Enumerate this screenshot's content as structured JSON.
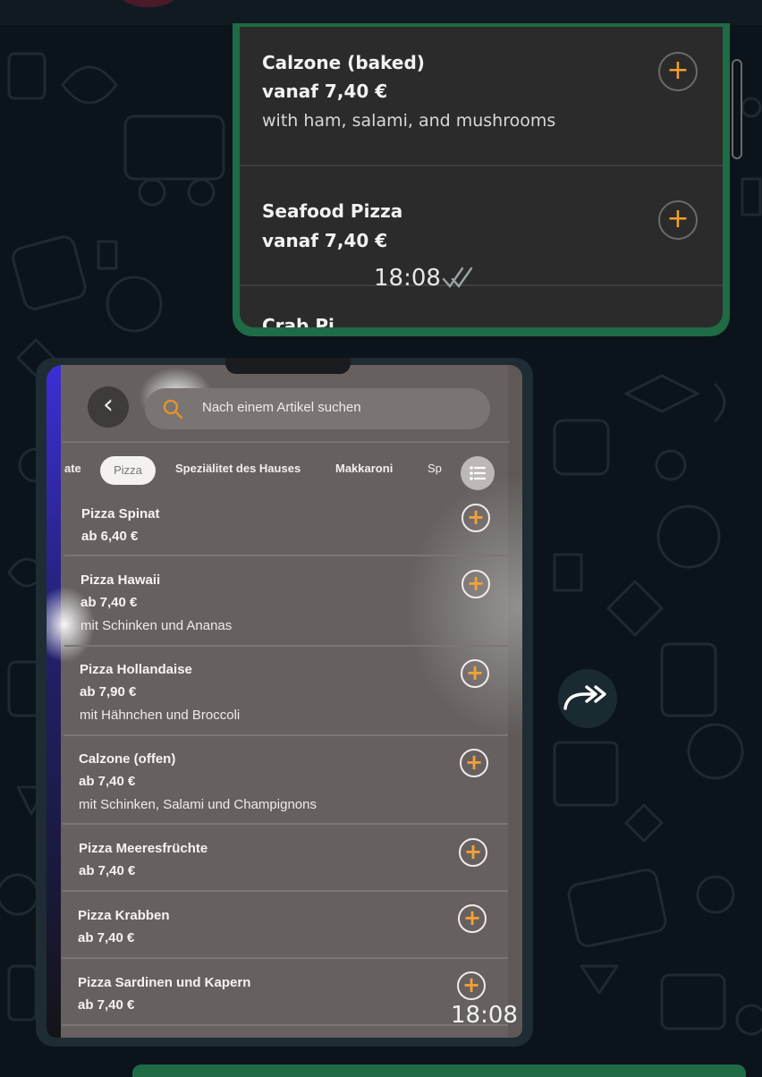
{
  "forwarded_menu": {
    "items": [
      {
        "name": "Calzone (baked)",
        "price": "vanaf 7,40 €",
        "desc": "with ham, salami, and mushrooms"
      },
      {
        "name": "Seafood Pizza",
        "price": "vanaf 7,40 €",
        "desc": ""
      }
    ],
    "cut_text": "Crab Pi",
    "time": "18:08",
    "add_icon": "plus-icon",
    "status_icon": "double-check-icon"
  },
  "photo": {
    "search_placeholder": "Nach einem Artikel suchen",
    "tabs": {
      "partial_left": "ate",
      "active": "Pizza",
      "t2": "Speziälitet des Hauses",
      "t3": "Makkaroni",
      "partial_right": "Sp"
    },
    "items": [
      {
        "name": "Pizza Spinat",
        "price": "ab 6,40 €",
        "desc": ""
      },
      {
        "name": "Pizza Hawaii",
        "price": "ab 7,40 €",
        "desc": "mit Schinken und Ananas"
      },
      {
        "name": "Pizza Hollandaise",
        "price": "ab 7,90 €",
        "desc": "mit Hähnchen und Broccoli"
      },
      {
        "name": "Calzone (offen)",
        "price": "ab 7,40 €",
        "desc": "mit Schinken, Salami und Champignons"
      },
      {
        "name": "Pizza Meeresfrüchte",
        "price": "ab 7,40 €",
        "desc": ""
      },
      {
        "name": "Pizza Krabben",
        "price": "ab 7,40 €",
        "desc": ""
      },
      {
        "name": "Pizza Sardinen und Kapern",
        "price": "ab 7,40 €",
        "desc": ""
      }
    ],
    "time": "18:08",
    "plus_glyph": "+",
    "back_glyph": "‹"
  },
  "colors": {
    "chat_bg": "#0b141a",
    "bubble_green": "#1e6b46",
    "accent_orange": "#f7a12a"
  }
}
